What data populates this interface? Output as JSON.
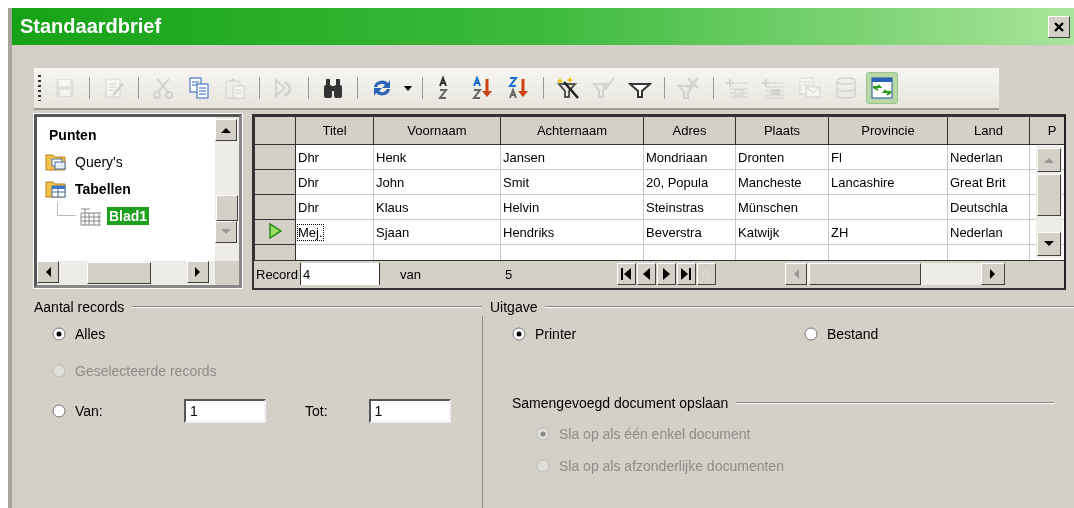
{
  "window": {
    "title": "Standaardbrief"
  },
  "toolbar": [
    {
      "kind": "grip"
    },
    {
      "kind": "save",
      "disabled": true
    },
    {
      "kind": "separator"
    },
    {
      "kind": "edit",
      "disabled": true
    },
    {
      "kind": "separator"
    },
    {
      "kind": "cut",
      "disabled": true
    },
    {
      "kind": "copy",
      "disabled": false
    },
    {
      "kind": "paste",
      "disabled": true
    },
    {
      "kind": "separator"
    },
    {
      "kind": "undo",
      "disabled": true
    },
    {
      "kind": "separator"
    },
    {
      "kind": "find",
      "disabled": false
    },
    {
      "kind": "separator"
    },
    {
      "kind": "refresh",
      "disabled": false
    },
    {
      "kind": "dropdown",
      "disabled": false
    },
    {
      "kind": "separator"
    },
    {
      "kind": "sort",
      "disabled": false
    },
    {
      "kind": "sort-ascending",
      "disabled": false
    },
    {
      "kind": "sort-descending",
      "disabled": false
    },
    {
      "kind": "separator"
    },
    {
      "kind": "autofilter",
      "disabled": false
    },
    {
      "kind": "standard-filter",
      "disabled": true
    },
    {
      "kind": "filter",
      "disabled": false
    },
    {
      "kind": "separator"
    },
    {
      "kind": "remove-filter",
      "disabled": true
    },
    {
      "kind": "separator"
    },
    {
      "kind": "data-to-text",
      "disabled": true
    },
    {
      "kind": "data-to-fields",
      "disabled": true
    },
    {
      "kind": "mail-merge",
      "disabled": true
    },
    {
      "kind": "data-source",
      "disabled": true
    },
    {
      "kind": "explorer",
      "disabled": false,
      "on": true
    }
  ],
  "tree": {
    "items": [
      {
        "label": "Punten",
        "expanded": true,
        "selected": false,
        "children": [
          {
            "label": "Query's",
            "kind": "queries",
            "expanded": false,
            "selected": false
          },
          {
            "label": "Tabellen",
            "kind": "tables",
            "expanded": true,
            "selected": false,
            "children": [
              {
                "label": "Blad1",
                "kind": "table",
                "selected": true
              }
            ]
          }
        ]
      }
    ]
  },
  "table": {
    "columns": [
      "Titel",
      "Voornaam",
      "Achternaam",
      "Adres",
      "Plaats",
      "Provincie",
      "Land",
      "P"
    ],
    "rows": [
      {
        "current": false,
        "cells": [
          "Dhr",
          "Henk",
          "Jansen",
          "Mondriaan",
          "Dronten",
          "Fl",
          "Nederlan"
        ]
      },
      {
        "current": false,
        "cells": [
          "Dhr",
          "John",
          "Smit",
          "20, Popula",
          "Mancheste",
          "Lancashire",
          "Great Brit"
        ]
      },
      {
        "current": false,
        "cells": [
          "Dhr",
          "Klaus",
          "Helvin",
          "Steinstras",
          "Münschen",
          "",
          "Deutschla"
        ]
      },
      {
        "current": true,
        "cells": [
          "Mej.",
          "Sjaan",
          "Hendriks",
          "Beverstra",
          "Katwijk",
          "ZH",
          "Nederlan"
        ]
      }
    ],
    "navigation": {
      "record_label": "Record",
      "record_value": "4",
      "of_label": "van",
      "total": "5"
    }
  },
  "records_group": {
    "title": "Aantal records",
    "options": [
      {
        "label": "Alles",
        "selected": true,
        "disabled": false
      },
      {
        "label": "Geselecteerde records",
        "selected": false,
        "disabled": true
      },
      {
        "label": "Van:",
        "selected": false,
        "disabled": false
      }
    ],
    "from_value": "1",
    "to_label": "Tot:",
    "to_value": "1"
  },
  "output_group": {
    "title": "Uitgave",
    "options": [
      {
        "label": "Printer",
        "selected": true,
        "disabled": false
      },
      {
        "label": "Bestand",
        "selected": false,
        "disabled": false
      }
    ],
    "save_section": {
      "title": "Samengevoegd document opslaan",
      "disabled": true,
      "options": [
        {
          "label": "Sla op als één enkel document",
          "selected": true
        },
        {
          "label": "Sla op als afzonderlijke documenten",
          "selected": false
        }
      ]
    }
  }
}
